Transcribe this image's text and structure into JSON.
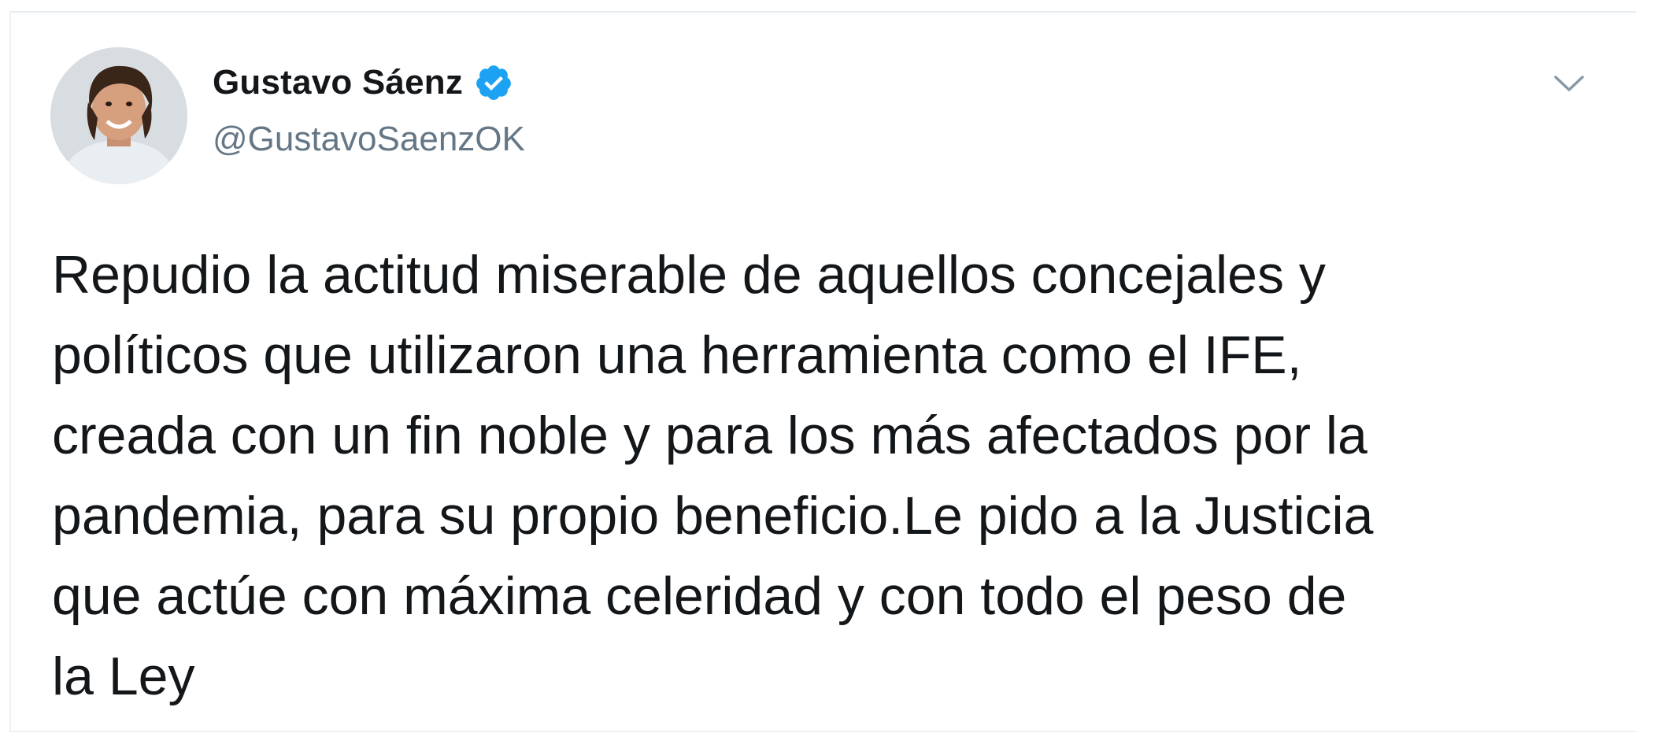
{
  "tweet": {
    "author": {
      "display_name": "Gustavo Sáenz",
      "handle": "@GustavoSaenzOK",
      "verified": true,
      "avatar_icon": "profile-photo"
    },
    "menu_icon": "chevron-down-icon",
    "text": "Repudio la actitud miserable de aquellos concejales y\npolíticos que utilizaron una herramienta como el IFE,\ncreada con un fin noble y para los más afectados por la\npandemia, para su propio beneficio.Le pido a la Justicia\nque actúe con máxima celeridad y con todo el peso de\nla Ley"
  },
  "colors": {
    "name": "#14171a",
    "handle": "#657786",
    "verified": "#1da1f2",
    "text": "#14171a"
  }
}
